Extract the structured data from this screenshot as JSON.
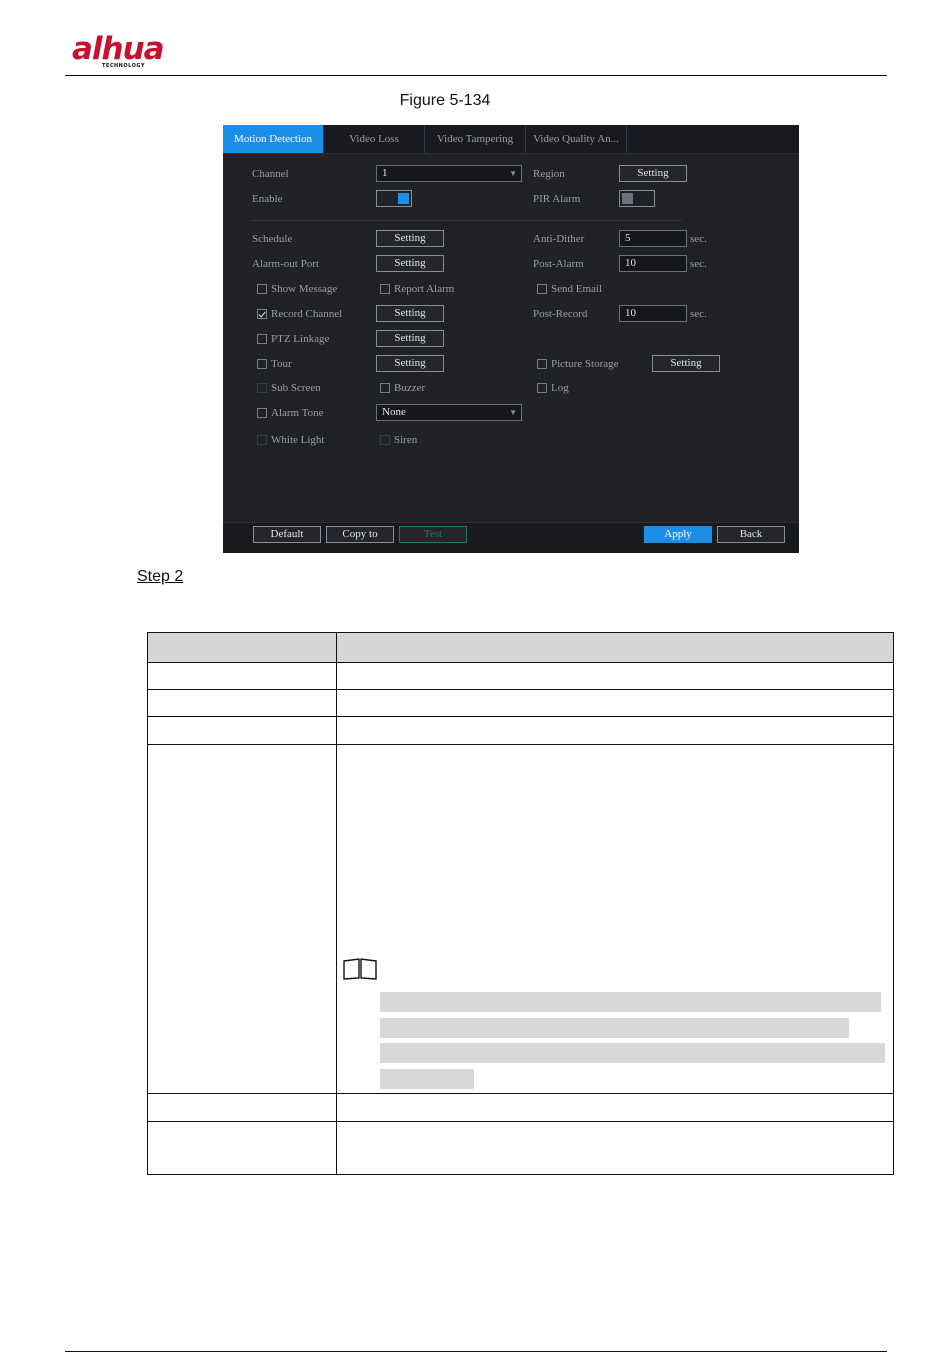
{
  "brand": {
    "logo_main": "alhua",
    "logo_sub": "TECHNOLOGY"
  },
  "figure": {
    "caption": "Figure 5-134"
  },
  "step": {
    "label": "Step 2"
  },
  "dvr": {
    "tabs": [
      {
        "label": "Motion Detection",
        "active": true
      },
      {
        "label": "Video Loss"
      },
      {
        "label": "Video Tampering"
      },
      {
        "label": "Video Quality An..."
      }
    ],
    "form": {
      "channel": {
        "label": "Channel",
        "value": "1"
      },
      "region": {
        "label": "Region",
        "button": "Setting"
      },
      "enable": {
        "label": "Enable",
        "state": "on"
      },
      "pir_alarm": {
        "label": "PIR Alarm",
        "state": "off"
      },
      "schedule": {
        "label": "Schedule",
        "button": "Setting"
      },
      "anti_dither": {
        "label": "Anti-Dither",
        "value": "5",
        "unit": "sec."
      },
      "alarm_out_port": {
        "label": "Alarm-out Port",
        "button": "Setting"
      },
      "post_alarm": {
        "label": "Post-Alarm",
        "value": "10",
        "unit": "sec."
      },
      "show_message": {
        "label": "Show Message",
        "checked": false
      },
      "report_alarm": {
        "label": "Report Alarm",
        "checked": false
      },
      "send_email": {
        "label": "Send Email",
        "checked": false
      },
      "record_channel": {
        "label": "Record Channel",
        "checked": true,
        "button": "Setting"
      },
      "post_record": {
        "label": "Post-Record",
        "value": "10",
        "unit": "sec."
      },
      "ptz_linkage": {
        "label": "PTZ Linkage",
        "checked": false,
        "button": "Setting"
      },
      "tour": {
        "label": "Tour",
        "checked": false,
        "button": "Setting"
      },
      "picture_storage": {
        "label": "Picture Storage",
        "checked": false,
        "button": "Setting"
      },
      "sub_screen": {
        "label": "Sub Screen",
        "checked": false
      },
      "buzzer": {
        "label": "Buzzer",
        "checked": false
      },
      "log": {
        "label": "Log",
        "checked": false
      },
      "alarm_tone": {
        "label": "Alarm Tone",
        "checked": false,
        "value": "None"
      },
      "white_light": {
        "label": "White Light",
        "checked": false
      },
      "siren": {
        "label": "Siren",
        "checked": false
      }
    },
    "buttons": {
      "default": "Default",
      "copy_to": "Copy to",
      "test": "Test",
      "apply": "Apply",
      "back": "Back"
    },
    "colors": {
      "accent": "#1b8fe8",
      "background": "#202227",
      "test_button": "#1f7d56"
    }
  }
}
